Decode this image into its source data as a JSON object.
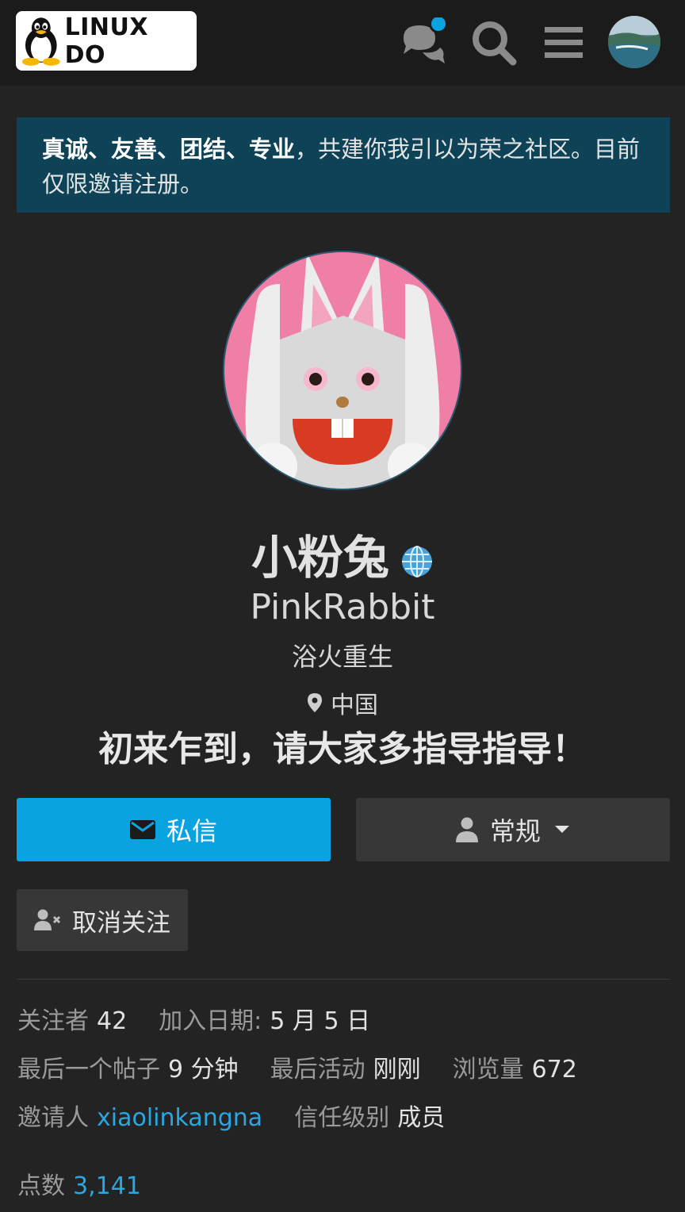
{
  "header": {
    "logo_text": "LINUX DO",
    "chat_icon": "chat-bubbles-icon",
    "search_icon": "search-icon",
    "menu_icon": "hamburger-menu-icon",
    "avatar_icon": "user-avatar",
    "notification_color": "#0aa3e1"
  },
  "banner": {
    "bold_text": "真诚、友善、团结、专业",
    "text": "，共建你我引以为荣之社区。目前仅限邀请注册。"
  },
  "profile": {
    "display_name": "小粉兔",
    "username": "PinkRabbit",
    "title": "浴火重生",
    "location": "中国",
    "bio": "初来乍到，请大家多指导指导！",
    "name_badge_icon": "globe-icon"
  },
  "actions": {
    "message_label": "私信",
    "notification_label": "常规",
    "unfollow_label": "取消关注",
    "accent_color": "#0aa3e1"
  },
  "stats": {
    "followers_label": "关注者",
    "followers_value": "42",
    "joined_label": "加入日期:",
    "joined_value": "5 月 5 日",
    "last_post_label": "最后一个帖子",
    "last_post_value": "9 分钟",
    "last_activity_label": "最后活动",
    "last_activity_value": "刚刚",
    "views_label": "浏览量",
    "views_value": "672",
    "invited_by_label": "邀请人",
    "invited_by_value": "xiaolinkangna",
    "trust_level_label": "信任级别",
    "trust_level_value": "成员",
    "points_label": "点数",
    "points_value": "3,141"
  }
}
